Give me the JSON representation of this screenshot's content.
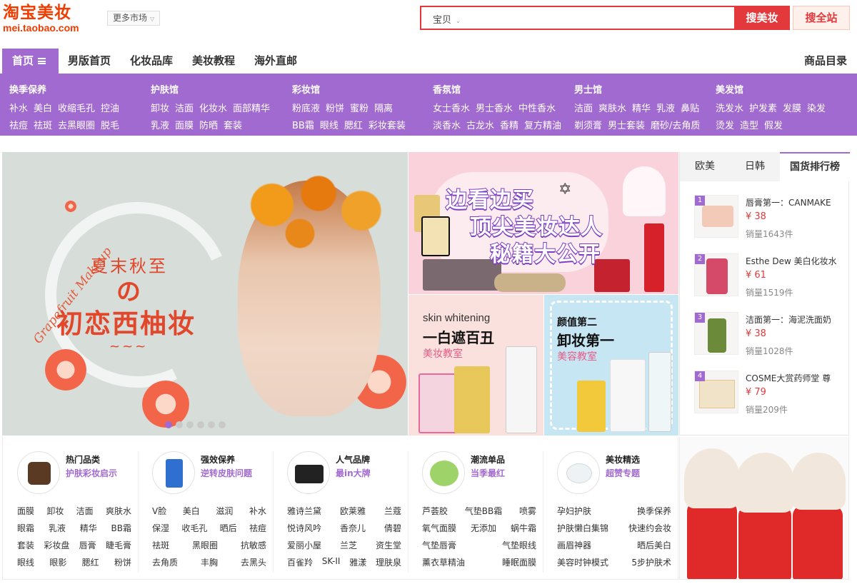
{
  "header": {
    "logo_cn": "淘宝美妆",
    "logo_en": "mei.taobao.com",
    "market_label": "更多市场",
    "search_type": "宝贝",
    "search_placeholder": "",
    "search_mei": "搜美妆",
    "search_all": "搜全站"
  },
  "nav": {
    "home": "首页",
    "items": [
      "男版首页",
      "化妆品库",
      "美妆教程",
      "海外直邮"
    ],
    "catalog": "商品目录"
  },
  "categories": [
    {
      "title": "换季保养",
      "row1": [
        "补水",
        "美白",
        "收缩毛孔",
        "控油"
      ],
      "row2": [
        "祛痘",
        "祛斑",
        "去黑眼圈",
        "脱毛"
      ]
    },
    {
      "title": "护肤馆",
      "row1": [
        "卸妆",
        "洁面",
        "化妆水",
        "面部精华"
      ],
      "row2": [
        "乳液",
        "面膜",
        "防晒",
        "套装"
      ]
    },
    {
      "title": "彩妆馆",
      "row1": [
        "粉底液",
        "粉饼",
        "蜜粉",
        "隔离"
      ],
      "row2": [
        "BB霜",
        "眼线",
        "腮红",
        "彩妆套装"
      ]
    },
    {
      "title": "香氛馆",
      "row1": [
        "女士香水",
        "男士香水",
        "中性香水"
      ],
      "row2": [
        "淡香水",
        "古龙水",
        "香精",
        "复方精油"
      ]
    },
    {
      "title": "男士馆",
      "row1": [
        "洁面",
        "爽肤水",
        "精华",
        "乳液",
        "鼻贴"
      ],
      "row2": [
        "剃须膏",
        "男士套装",
        "磨砂/去角质"
      ]
    },
    {
      "title": "美发馆",
      "row1": [
        "洗发水",
        "护发素",
        "发膜",
        "染发"
      ],
      "row2": [
        "烫发",
        "造型",
        "假发"
      ]
    }
  ],
  "hero": {
    "script": "Grapefruit Makeup",
    "subtitle": "夏末秋至",
    "no": "の",
    "title": "初恋西柚妆",
    "wave": "~~~",
    "slide_count": 6,
    "active_slide": 0
  },
  "promo_top": {
    "lines": [
      "边看边买",
      "顶尖美妆达人",
      "秘籍大公开"
    ]
  },
  "promo_left": {
    "en": "skin whitening",
    "cn": "一白遮百丑",
    "tag": "美妆教室"
  },
  "promo_right": {
    "l1": "颜值第二",
    "l2": "卸妆第一",
    "l3": "美容教室"
  },
  "ranking": {
    "tabs": [
      "欧美",
      "日韩",
      "国货排行榜"
    ],
    "items": [
      {
        "rank": "1",
        "name": "唇膏第一：CANMAKE",
        "price": "¥ 38",
        "sales": "销量1643件"
      },
      {
        "rank": "2",
        "name": "Esthe Dew 美白化妆水",
        "price": "¥ 61",
        "sales": "销量1519件"
      },
      {
        "rank": "3",
        "name": "洁面第一：海泥洗面奶",
        "price": "¥ 38",
        "sales": "销量1028件"
      },
      {
        "rank": "4",
        "name": "COSME大赏药师堂 尊",
        "price": "¥ 79",
        "sales": "销量209件"
      }
    ]
  },
  "bottom": [
    {
      "head": "热门品类",
      "sub": "护肤彩妆启示",
      "rows": [
        [
          "面膜",
          "卸妆",
          "洁面",
          "爽肤水"
        ],
        [
          "眼霜",
          "乳液",
          "精华",
          "BB霜"
        ],
        [
          "套装",
          "彩妆盘",
          "唇膏",
          "睫毛膏"
        ],
        [
          "眼线",
          "眼影",
          "腮红",
          "粉饼"
        ]
      ]
    },
    {
      "head": "强效保养",
      "sub": "逆转皮肤问题",
      "rows": [
        [
          "V脸",
          "美白",
          "滋润",
          "补水"
        ],
        [
          "保湿",
          "收毛孔",
          "晒后",
          "祛痘"
        ],
        [
          "祛斑",
          "黑眼圈",
          "抗敏感"
        ],
        [
          "去角质",
          "丰胸",
          "去黑头"
        ]
      ]
    },
    {
      "head": "人气品牌",
      "sub": "最in大牌",
      "rows": [
        [
          "雅诗兰黛",
          "欧莱雅",
          "兰蔻"
        ],
        [
          "悦诗风吟",
          "香奈儿",
          "倩碧"
        ],
        [
          "爱丽小屋",
          "兰芝",
          "资生堂"
        ],
        [
          "百雀羚",
          "SK-II",
          "雅漾",
          "理肤泉"
        ]
      ]
    },
    {
      "head": "潮流单品",
      "sub": "当季最红",
      "rows": [
        [
          "芦荟胶",
          "气垫BB霜",
          "喷雾"
        ],
        [
          "氧气面膜",
          "无添加",
          "蜗牛霜"
        ],
        [
          "气垫唇膏",
          "气垫眼线"
        ],
        [
          "薰衣草精油",
          "睡眠面膜"
        ]
      ]
    },
    {
      "head": "美妆精选",
      "sub": "超赞专题",
      "rows": [
        [
          "孕妇护肤",
          "换季保养"
        ],
        [
          "护肤懒白集锦",
          "快速约会妆"
        ],
        [
          "画眉神器",
          "晒后美白"
        ],
        [
          "美容时钟模式",
          "5步护肤术"
        ]
      ]
    }
  ],
  "colors": {
    "brand": "#f03c00",
    "accent": "#a16ad0",
    "search": "#e4393c"
  }
}
